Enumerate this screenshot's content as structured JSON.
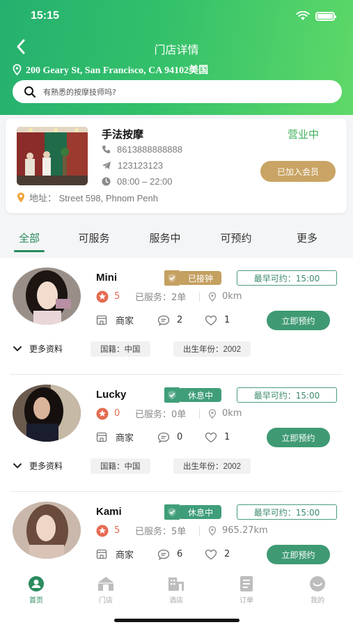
{
  "status_bar": {
    "time": "15:15"
  },
  "nav": {
    "title": "门店详情",
    "address": "200 Geary St, San Francisco, CA 94102美国"
  },
  "search": {
    "placeholder": "有熟悉的按摩技师吗?"
  },
  "store": {
    "name": "手法按摩",
    "status": "营业中",
    "phone": "8613888888888",
    "telegram": "123123123",
    "hours": "08:00 – 22:00",
    "member_button": "已加入会员",
    "address": "地址： Street 598, Phnom Penh"
  },
  "tabs": [
    {
      "label": "全部",
      "active": true
    },
    {
      "label": "可服务"
    },
    {
      "label": "服务中"
    },
    {
      "label": "可预约"
    },
    {
      "label": "更多"
    }
  ],
  "technicians": [
    {
      "name": "Mini",
      "status": "已接钟",
      "status_color": "#c4a061",
      "earliest": "最早可约：15:00",
      "rating": "5",
      "served": "已服务：2单",
      "distance": "0km",
      "merchant": "商家",
      "comments": "2",
      "likes": "1",
      "book": "立即预约",
      "more": "更多资料",
      "nationality": "国籍：中国",
      "birth_year": "出生年份：2002"
    },
    {
      "name": "Lucky",
      "status": "休息中",
      "status_color": "#3f9e79",
      "earliest": "最早可约：15:00",
      "rating": "0",
      "served": "已服务：0单",
      "distance": "0km",
      "merchant": "商家",
      "comments": "0",
      "likes": "1",
      "book": "立即预约",
      "more": "更多资料",
      "nationality": "国籍：中国",
      "birth_year": "出生年份：2002"
    },
    {
      "name": "Kami",
      "status": "休息中",
      "status_color": "#3f9e79",
      "earliest": "最早可约：15:00",
      "rating": "5",
      "served": "已服务：5单",
      "distance": "965.27km",
      "merchant": "商家",
      "comments": "6",
      "likes": "2",
      "book": "立即预约"
    }
  ],
  "tabbar": [
    {
      "label": "首页",
      "icon": "home-icon",
      "active": true
    },
    {
      "label": "门店",
      "icon": "store-icon"
    },
    {
      "label": "酒店",
      "icon": "hotel-icon"
    },
    {
      "label": "订单",
      "icon": "order-icon"
    },
    {
      "label": "我的",
      "icon": "profile-icon"
    }
  ],
  "colors": {
    "primary": "#2a8a5e",
    "header_gradient_start": "#25b06f",
    "header_gradient_end": "#5fd968",
    "gold": "#c9a464"
  }
}
